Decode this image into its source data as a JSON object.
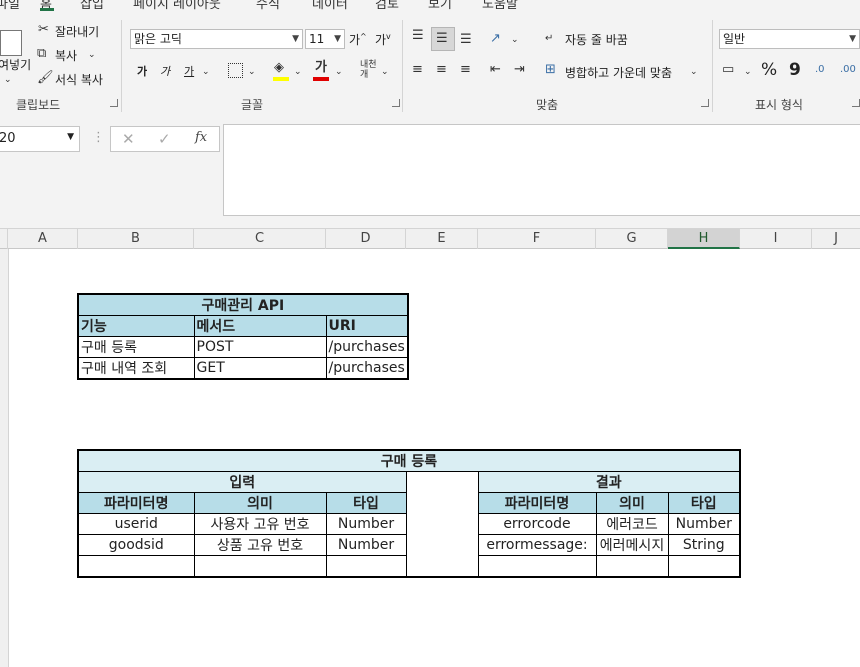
{
  "ribbon": {
    "tabs": [
      "파일",
      "홈",
      "삽입",
      "페이지 레이아웃",
      "수식",
      "데이터",
      "검토",
      "보기",
      "도움말"
    ],
    "clipboard": {
      "paste_fragment": "여넣기",
      "cut": "잘라내기",
      "copy": "복사",
      "format_painter": "서식 복사",
      "group": "클립보드"
    },
    "font": {
      "name": "맑은 고딕",
      "size": "11",
      "group": "글꼴",
      "bold": "가",
      "italic": "가",
      "underline": "가",
      "grow": "가",
      "shrink": "가"
    },
    "alignment": {
      "wrap": "자동 줄 바꿈",
      "merge": "병합하고 가운데 맞춤",
      "group": "맞춤"
    },
    "number": {
      "format": "일반",
      "group": "표시 형식",
      "percent": "%",
      "comma": "9"
    }
  },
  "formula_bar": {
    "name_box": "20",
    "fx": "fx",
    "content": ""
  },
  "columns": [
    "A",
    "B",
    "C",
    "D",
    "E",
    "F",
    "G",
    "H",
    "I",
    "J"
  ],
  "table1": {
    "title": "구매관리 API",
    "headers": [
      "기능",
      "메서드",
      "URI"
    ],
    "rows": [
      [
        "구매 등록",
        "POST",
        "/purchases"
      ],
      [
        "구매 내역 조회",
        "GET",
        "/purchases"
      ]
    ]
  },
  "table2": {
    "title": "구매 등록",
    "input_label": "입력",
    "result_label": "결과",
    "input_headers": [
      "파라미터명",
      "의미",
      "타입"
    ],
    "result_headers": [
      "파라미터명",
      "의미",
      "타입"
    ],
    "input_rows": [
      [
        "userid",
        "사용자 고유 번호",
        "Number"
      ],
      [
        "goodsid",
        "상품 고유 번호",
        "Number"
      ],
      [
        "",
        "",
        ""
      ]
    ],
    "result_rows": [
      [
        "errorcode",
        "에러코드",
        "Number"
      ],
      [
        "errormessage:",
        "에러메시지",
        "String"
      ],
      [
        "",
        "",
        ""
      ]
    ]
  },
  "accent": "#217346",
  "header_fill": "#b7dde8"
}
